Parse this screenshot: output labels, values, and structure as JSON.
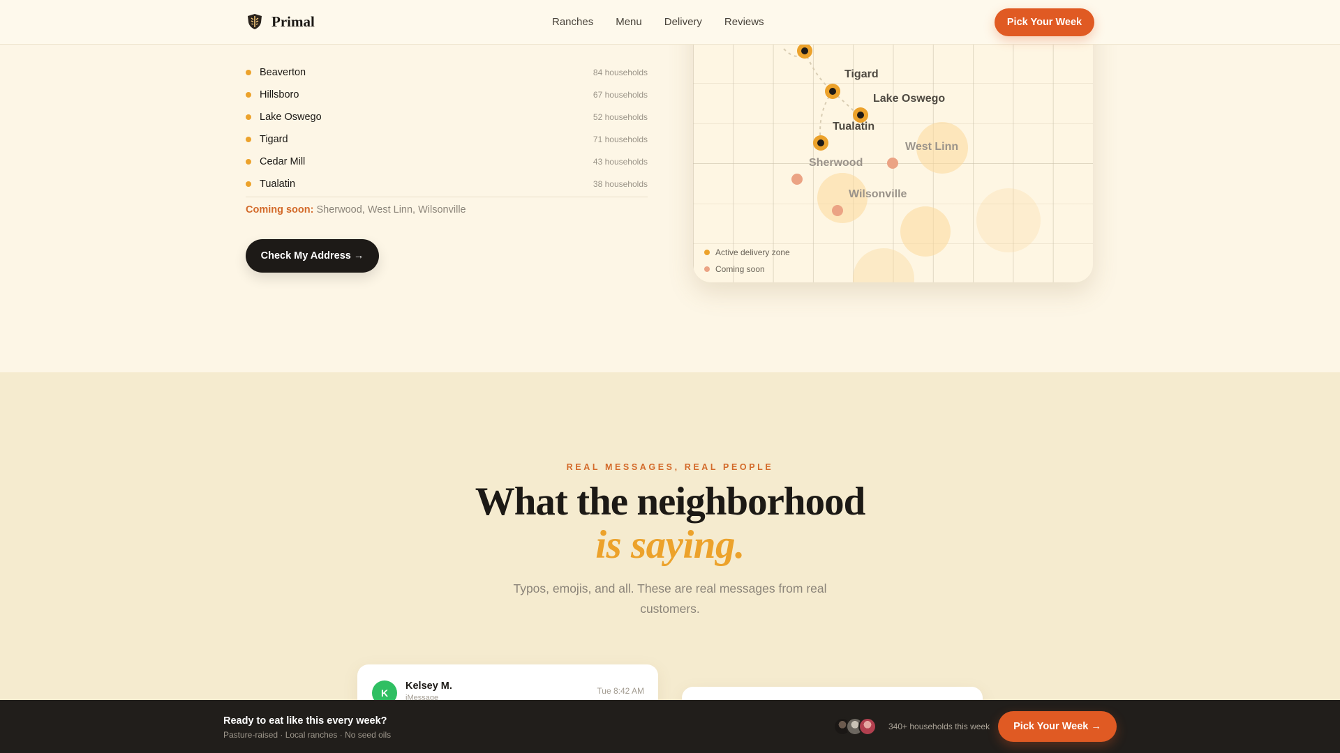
{
  "brand": {
    "name": "Primal",
    "logo_icon": "shield-icon"
  },
  "nav": {
    "links": [
      "Ranches",
      "Menu",
      "Delivery",
      "Reviews"
    ],
    "cta_label": "Pick Your Week"
  },
  "service_areas": [
    {
      "name": "Beaverton",
      "count": "84 households"
    },
    {
      "name": "Hillsboro",
      "count": "67 households"
    },
    {
      "name": "Lake Oswego",
      "count": "52 households"
    },
    {
      "name": "Tigard",
      "count": "71 households"
    },
    {
      "name": "Cedar Mill",
      "count": "43 households"
    },
    {
      "name": "Tualatin",
      "count": "38 households"
    }
  ],
  "coming_soon": {
    "label": "Coming soon:",
    "areas": "Sherwood, West Linn, Wilsonville"
  },
  "check_address_label": "Check My Address →",
  "map": {
    "active_labels": [
      "Tigard",
      "Lake Oswego",
      "Tualatin"
    ],
    "soon_labels": [
      "Sherwood",
      "West Linn",
      "Wilsonville"
    ],
    "legend": [
      {
        "label": "Active delivery zone",
        "color": "#eca22b"
      },
      {
        "label": "Coming soon",
        "color": "#eba384"
      }
    ]
  },
  "testimonials": {
    "eyebrow": "REAL MESSAGES, REAL PEOPLE",
    "headline": "What the neighborhood",
    "headline_accent": "is saying.",
    "subhead": "Typos, emojis, and all. These are real messages from real customers.",
    "messages": [
      {
        "initial": "K",
        "name": "Kelsey M.",
        "app": "iMessage",
        "time": "Tue 8:42 AM"
      }
    ]
  },
  "sticky_bar": {
    "title": "Ready to eat like this every week?",
    "subtitle": "Pasture-raised · Local ranches · No seed oils",
    "count": "340+ households this week",
    "cta_label": "Pick Your Week →"
  },
  "colors": {
    "accent_orange": "#e05a23",
    "accent_amber": "#eca22b",
    "dark": "#1d1a17",
    "cream": "#fdf6e6"
  }
}
